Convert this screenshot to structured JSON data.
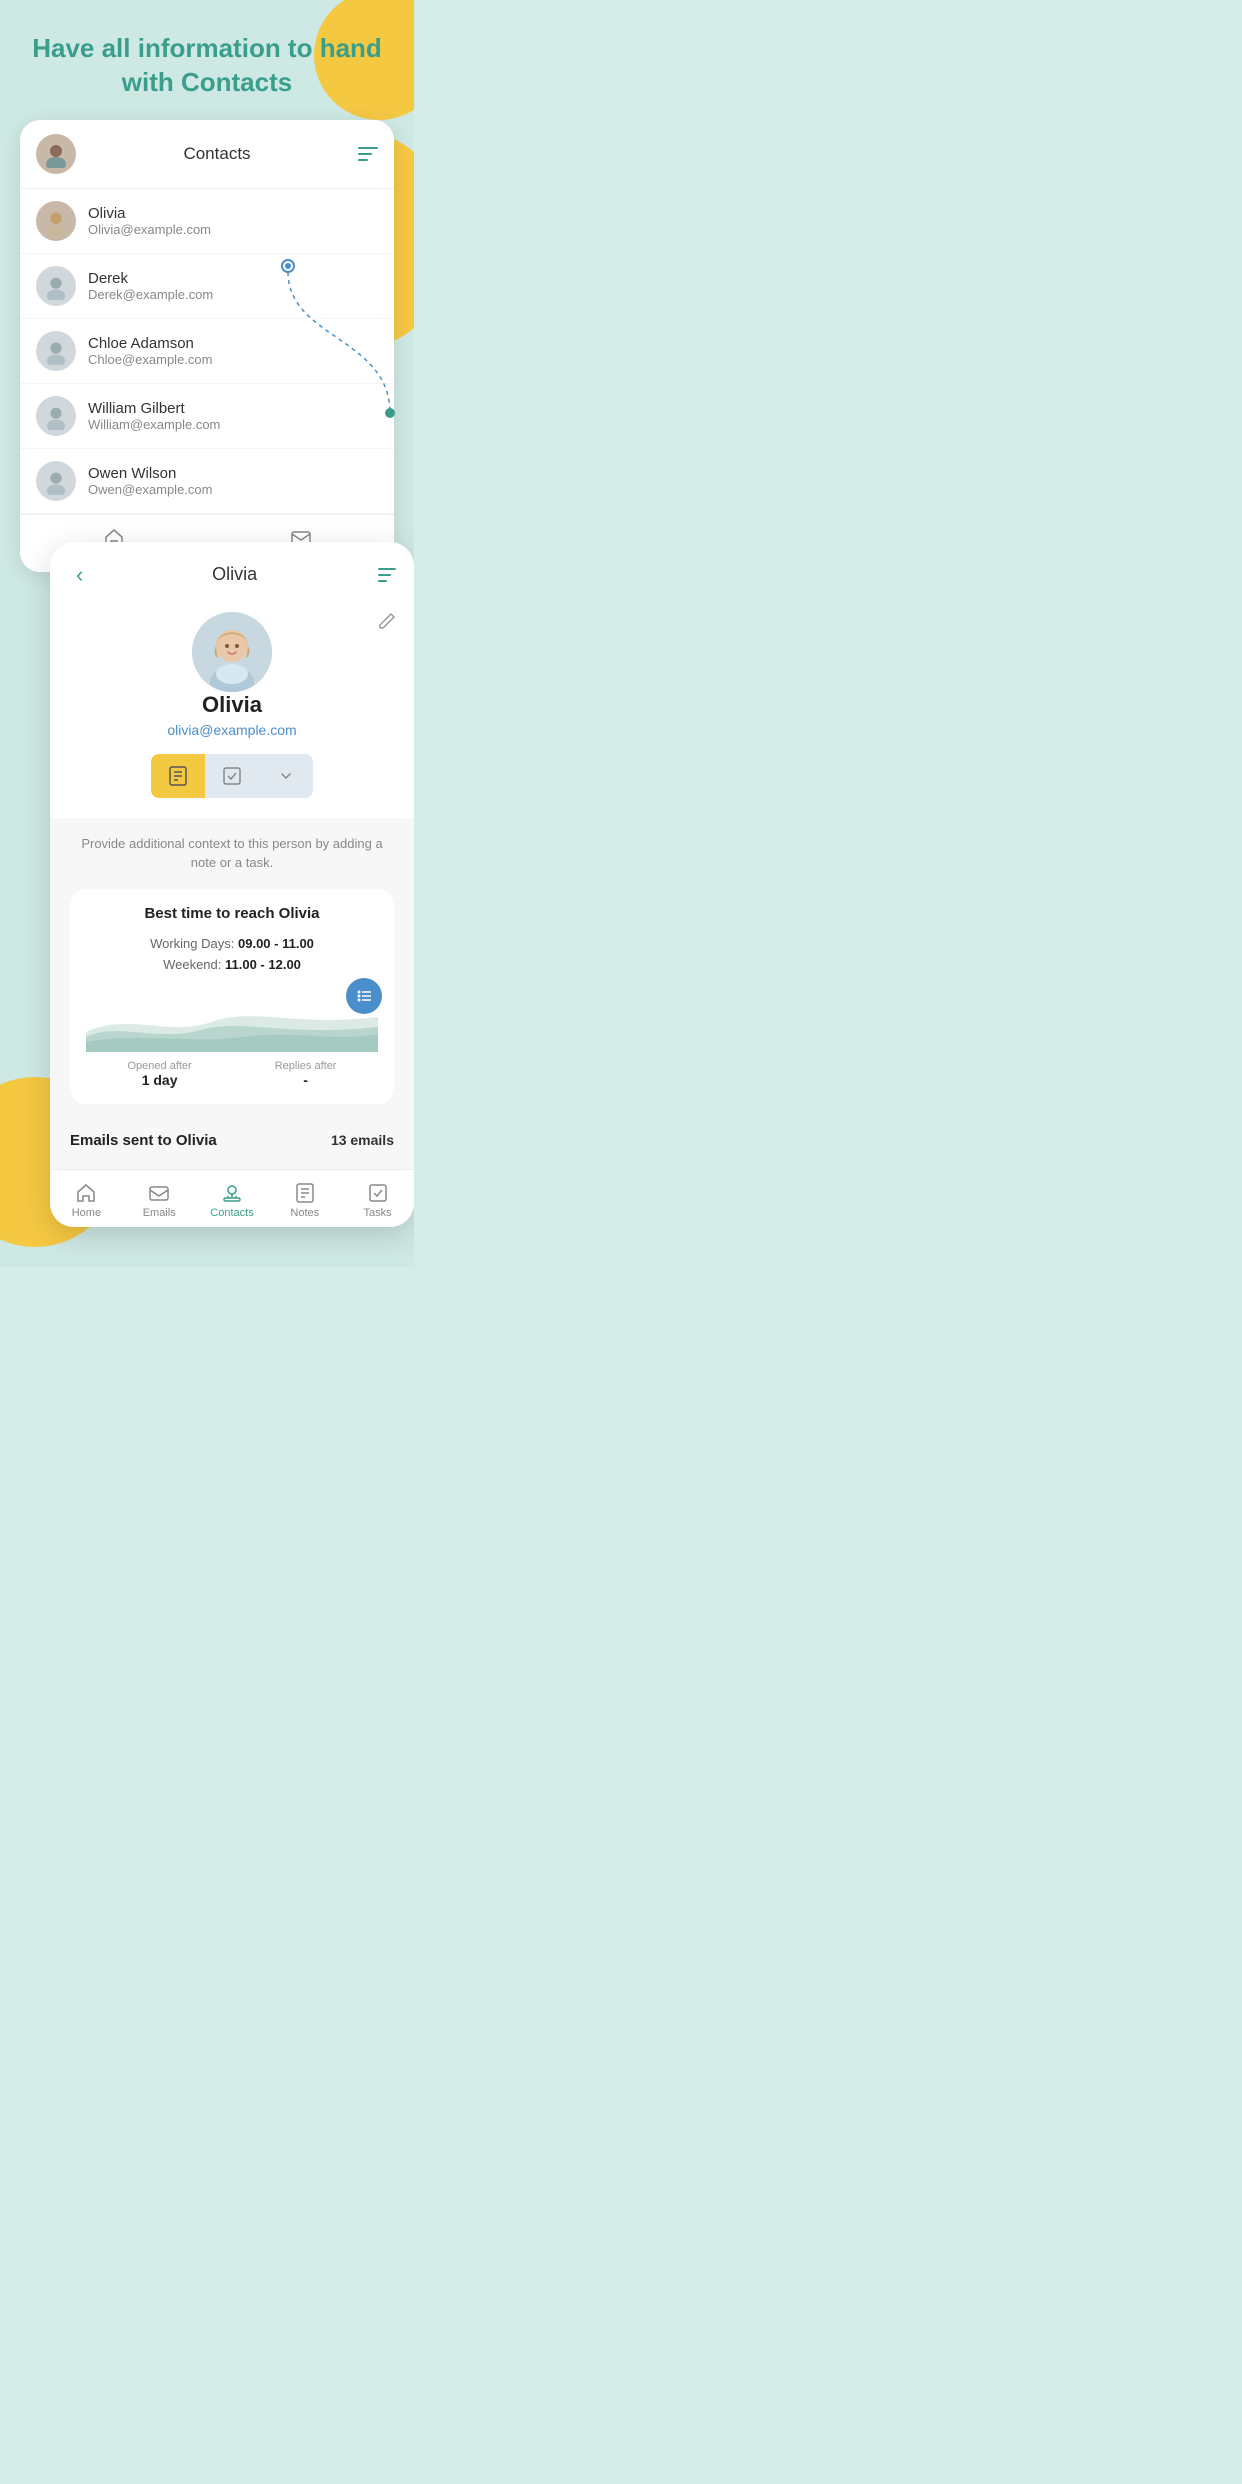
{
  "page": {
    "header": "Have all information to hand with Contacts",
    "bg_color": "#cee8e4"
  },
  "contacts_card": {
    "title": "Contacts",
    "contacts": [
      {
        "name": "Olivia",
        "email": "Olivia@example.com",
        "type": "olivia"
      },
      {
        "name": "Derek",
        "email": "Derek@example.com",
        "type": "generic"
      },
      {
        "name": "Chloe Adamson",
        "email": "Chloe@example.com",
        "type": "generic"
      },
      {
        "name": "William Gilbert",
        "email": "William@example.com",
        "type": "generic"
      },
      {
        "name": "Owen  Wilson",
        "email": "Owen@example.com",
        "type": "generic"
      }
    ],
    "nav": {
      "home": "Home",
      "emails": "Emails"
    }
  },
  "detail_card": {
    "title": "Olivia",
    "name": "Olivia",
    "email": "olivia@example.com",
    "hint": "Provide additional context to this person by adding a note or a task.",
    "best_time": {
      "title": "Best time to reach Olivia",
      "working_days_label": "Working Days:",
      "working_days_value": "09.00 - 11.00",
      "weekend_label": "Weekend:",
      "weekend_value": "11.00 - 12.00",
      "opened_after_label": "Opened after",
      "opened_after_value": "1 day",
      "replies_after_label": "Replies after",
      "replies_after_value": "-"
    },
    "emails_sent_label": "Emails sent to Olivia",
    "emails_count": "13 emails",
    "nav": {
      "home": "Home",
      "emails": "Emails",
      "contacts": "Contacts",
      "notes": "Notes",
      "tasks": "Tasks"
    }
  }
}
